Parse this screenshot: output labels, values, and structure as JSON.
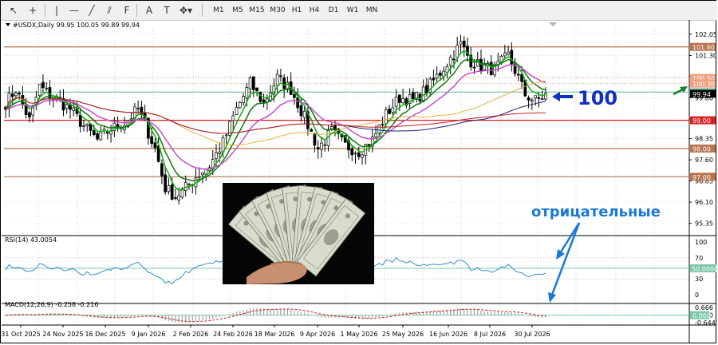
{
  "toolbar": {
    "tools": [
      {
        "name": "cursor-icon",
        "glyph": "↖"
      },
      {
        "name": "crosshair-icon",
        "glyph": "+"
      },
      {
        "name": "vertical-line-icon",
        "glyph": "|"
      },
      {
        "name": "horizontal-line-icon",
        "glyph": "—"
      },
      {
        "name": "trendline-icon",
        "glyph": "╱"
      },
      {
        "name": "channel-icon",
        "glyph": "⫽"
      },
      {
        "name": "fibonacci-icon",
        "glyph": "F"
      },
      {
        "name": "text-tool-icon",
        "glyph": "A"
      },
      {
        "name": "label-tool-icon",
        "glyph": "T"
      },
      {
        "name": "shapes-menu-icon",
        "glyph": "✥▾"
      }
    ],
    "timeframes": [
      "M1",
      "M5",
      "M15",
      "M30",
      "H1",
      "H4",
      "D1",
      "W1",
      "MN"
    ]
  },
  "chart_data": [
    {
      "type": "candlestick",
      "panel": "main",
      "header": "#USDX,Daily  99.95 100.05 99.89 99.94",
      "ylim": [
        95.0,
        102.3
      ],
      "yticks": [
        "102.05",
        "101.30",
        "100.55",
        "99.80",
        "99.05",
        "98.35",
        "97.60",
        "96.85",
        "96.10",
        "95.35"
      ],
      "price_boxes": [
        {
          "label": "101.60",
          "value": 101.6,
          "bg": "#b8744e",
          "fg": "#ffffff"
        },
        {
          "label": "100.50",
          "value": 100.5,
          "bg": "#f0a080",
          "fg": "#ffffff"
        },
        {
          "label": "100.30",
          "value": 100.3,
          "bg": "#f0a080",
          "fg": "#ffffff"
        },
        {
          "label": "100.00",
          "value": 100.0,
          "bg": "#7ac8a8",
          "fg": "#ffffff"
        },
        {
          "label": "99.94",
          "value": 99.94,
          "bg": "#000000",
          "fg": "#ffffff"
        },
        {
          "label": "99.00",
          "value": 99.0,
          "bg": "#d82020",
          "fg": "#ffffff"
        },
        {
          "label": "98.00",
          "value": 98.0,
          "bg": "#b8744e",
          "fg": "#ffffff"
        },
        {
          "label": "97.00",
          "value": 97.0,
          "bg": "#b8744e",
          "fg": "#ffffff"
        }
      ],
      "horizontal_levels": [
        {
          "value": 101.6,
          "color": "#b8744e",
          "style": "solid"
        },
        {
          "value": 100.5,
          "color": "#e8a080",
          "style": "dotted"
        },
        {
          "value": 100.3,
          "color": "#e8a080",
          "style": "dotted"
        },
        {
          "value": 100.0,
          "color": "#70c0a0",
          "style": "solid"
        },
        {
          "value": 99.0,
          "color": "#d82020",
          "style": "solid"
        },
        {
          "value": 98.0,
          "color": "#b8744e",
          "style": "solid"
        },
        {
          "value": 97.0,
          "color": "#b8744e",
          "style": "solid"
        }
      ],
      "close_anchors": [
        [
          0,
          99.6
        ],
        [
          3,
          100.1
        ],
        [
          7,
          99.0
        ],
        [
          10,
          100.2
        ],
        [
          14,
          99.8
        ],
        [
          19,
          99.4
        ],
        [
          23,
          98.8
        ],
        [
          27,
          98.3
        ],
        [
          31,
          98.7
        ],
        [
          35,
          98.9
        ],
        [
          39,
          99.4
        ],
        [
          44,
          98.0
        ],
        [
          47,
          96.6
        ],
        [
          50,
          96.3
        ],
        [
          53,
          96.6
        ],
        [
          56,
          97.0
        ],
        [
          60,
          97.4
        ],
        [
          64,
          98.2
        ],
        [
          68,
          99.4
        ],
        [
          72,
          100.3
        ],
        [
          76,
          99.6
        ],
        [
          80,
          100.5
        ],
        [
          84,
          100.1
        ],
        [
          88,
          99.1
        ],
        [
          92,
          98.0
        ],
        [
          96,
          98.6
        ],
        [
          100,
          98.1
        ],
        [
          104,
          97.9
        ],
        [
          108,
          98.3
        ],
        [
          112,
          99.2
        ],
        [
          116,
          99.8
        ],
        [
          120,
          99.7
        ],
        [
          124,
          100.1
        ],
        [
          128,
          100.7
        ],
        [
          131,
          101.2
        ],
        [
          134,
          101.7
        ],
        [
          137,
          101.1
        ],
        [
          140,
          100.9
        ],
        [
          144,
          100.8
        ],
        [
          148,
          101.3
        ],
        [
          151,
          100.5
        ],
        [
          153,
          99.9
        ],
        [
          156,
          99.7
        ],
        [
          159,
          99.9
        ]
      ],
      "candle_count": 160,
      "indicators": [
        {
          "name": "ema-fast",
          "color": "#12b012",
          "width": 1.5,
          "period": 5
        },
        {
          "name": "ema-mid",
          "color": "#0a7a0a",
          "width": 1.5,
          "period": 10
        },
        {
          "name": "ema-slow",
          "color": "#c050c8",
          "width": 1.5,
          "period": 20
        },
        {
          "name": "ma-gold",
          "color": "#e8b040",
          "width": 1,
          "period": 50
        },
        {
          "name": "ma-navy",
          "color": "#20207a",
          "width": 1,
          "period": 100
        },
        {
          "name": "ma-red",
          "color": "#c02020",
          "width": 1,
          "period": 200
        }
      ],
      "annotation_100": "100",
      "x_ticks": [
        "31 Oct 2025",
        "24 Nov 2025",
        "16 Dec 2025",
        "9 Jan 2026",
        "2 Feb 2026",
        "24 Feb 2026",
        "18 Mar 2026",
        "9 Apr 2026",
        "1 May 2026",
        "25 May 2026",
        "16 Jun 2026",
        "8 Jul 2026",
        "30 Jul 2026"
      ]
    },
    {
      "type": "line",
      "panel": "rsi",
      "header": "RSI(14) 43.0054",
      "ylim": [
        0,
        100
      ],
      "yticks": [
        "100",
        "70",
        "50",
        "30",
        "0"
      ],
      "level_box": {
        "label": "50.0000",
        "value": 50,
        "bg": "#7ac8a8",
        "fg": "#ffffff"
      },
      "levels": [
        70,
        50,
        30
      ],
      "color": "#3a8ad0"
    },
    {
      "type": "histogram",
      "panel": "macd",
      "header": "MACD(12,26,9) -0.258 -0.216",
      "ylim": [
        -0.7,
        0.72
      ],
      "yticks": [
        "0.666",
        "0.000",
        "-0.644"
      ],
      "zero_box": {
        "label": "0.000",
        "value": 0,
        "bg": "#7ac8a8",
        "fg": "#ffffff"
      },
      "histogram_color": "#a0a0a0",
      "signal_color": "#c02020"
    }
  ],
  "annotations": {
    "negative_label": "отрицательные",
    "negative_color": "#1a78d8",
    "arrow_100_color": "#1030c0",
    "green_arrow_color": "#108030"
  }
}
